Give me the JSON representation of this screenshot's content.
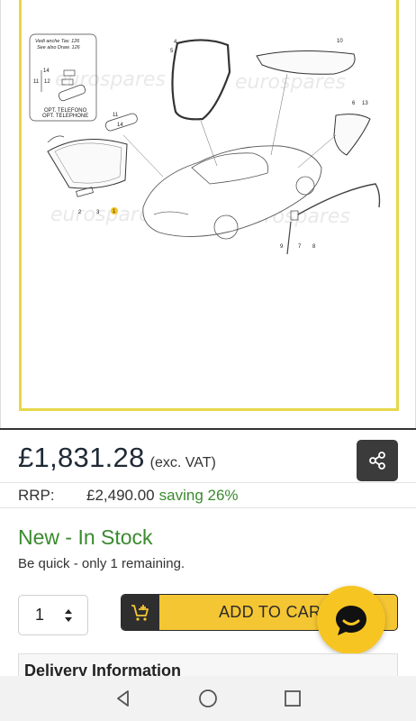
{
  "diagram": {
    "note_line1": "Vedi anche Tav. 126",
    "note_line2": "See also Draw. 126",
    "opt_line1": "OPT. TELEFONO",
    "opt_line2": "OPT. TELEPHONE",
    "watermark": "eurospares",
    "part_numbers": [
      "14",
      "11",
      "12",
      "11",
      "14",
      "4",
      "5",
      "10",
      "6",
      "13",
      "2",
      "3",
      "1",
      "9",
      "7",
      "8"
    ]
  },
  "product": {
    "price": "£1,831.28",
    "vat_note": "(exc. VAT)",
    "rrp_label": "RRP:",
    "rrp_value": "£2,490.00",
    "saving_text": "saving 26%",
    "stock_status": "New - In Stock",
    "stock_note": "Be quick - only 1 remaining.",
    "quantity": "1",
    "add_to_cart_label": "ADD TO CART",
    "delivery_heading": "Delivery Information"
  },
  "icons": {
    "share": "share-icon",
    "cart": "cart-add-icon",
    "chat": "chat-bubble-icon",
    "back": "nav-back-icon",
    "home": "nav-home-icon",
    "recents": "nav-recents-icon"
  },
  "colors": {
    "accent_yellow": "#f5c633",
    "stock_green": "#3a8a2e",
    "frame_yellow": "#e6d84a",
    "dark": "#2e2e2e"
  }
}
